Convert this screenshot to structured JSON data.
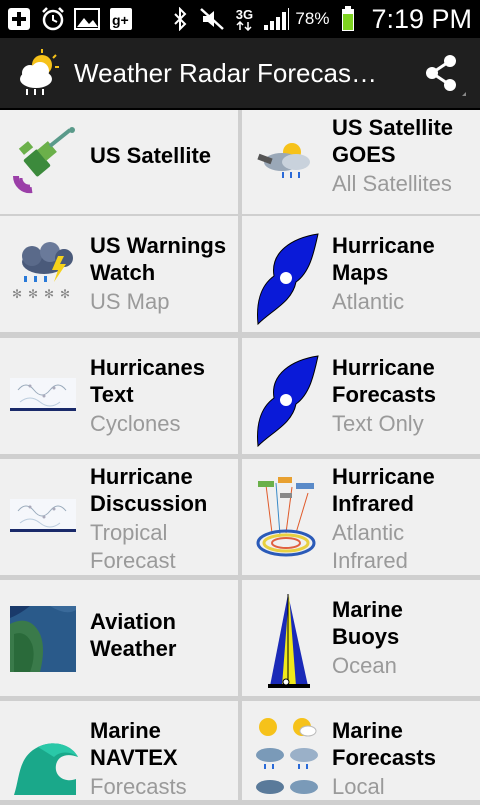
{
  "status_bar": {
    "network": "3G",
    "battery": "78%",
    "time": "7:19 PM"
  },
  "app_bar": {
    "title": "Weather Radar Forecas…"
  },
  "tiles": [
    {
      "title": "US Satellite",
      "subtitle": "",
      "icon": "satellite-icon"
    },
    {
      "title": "US Satellite GOES",
      "subtitle": "All Satellites",
      "icon": "satellite-cloud-icon"
    },
    {
      "title": "US Warnings Watch",
      "subtitle": "US Map",
      "icon": "storm-cloud-icon"
    },
    {
      "title": "Hurricane Maps",
      "subtitle": "Atlantic",
      "icon": "hurricane-icon"
    },
    {
      "title": "Hurricanes Text",
      "subtitle": "Cyclones",
      "icon": "forecast-map-icon"
    },
    {
      "title": "Hurricane Forecasts",
      "subtitle": "Text Only",
      "icon": "hurricane-icon"
    },
    {
      "title": "Hurricane Discussion",
      "subtitle": "Tropical Forecast",
      "icon": "forecast-map-icon"
    },
    {
      "title": "Hurricane Infrared",
      "subtitle": "Atlantic Infrared",
      "icon": "infrared-satellites-icon"
    },
    {
      "title": "Aviation Weather",
      "subtitle": "",
      "icon": "aerial-map-icon"
    },
    {
      "title": "Marine Buoys",
      "subtitle": "Ocean",
      "icon": "buoy-icon"
    },
    {
      "title": "Marine NAVTEX",
      "subtitle": "Forecasts",
      "icon": "wave-icon"
    },
    {
      "title": "Marine Forecasts",
      "subtitle": "Local",
      "icon": "weather-grid-icon"
    }
  ]
}
